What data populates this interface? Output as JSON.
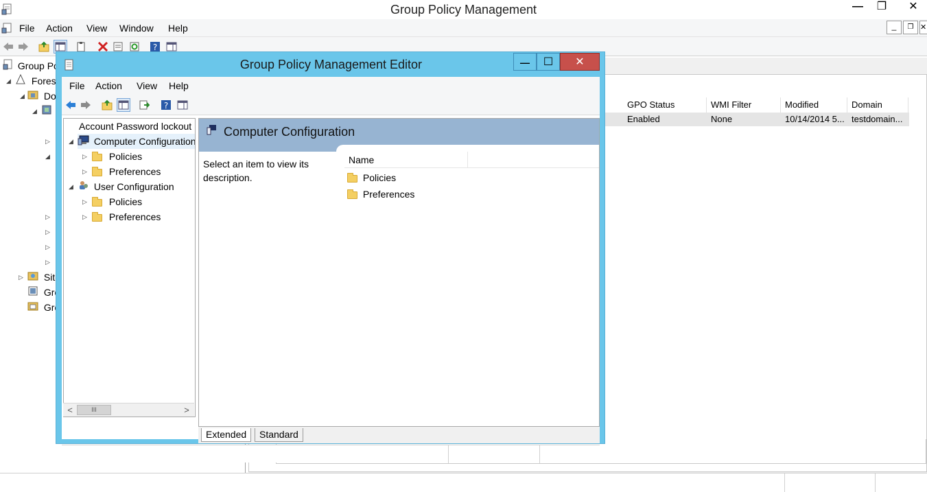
{
  "main_window": {
    "title": "Group Policy Management",
    "menu": [
      "File",
      "Action",
      "View",
      "Window",
      "Help"
    ],
    "caption_buttons": {
      "minimize": "—",
      "maximize": "❐",
      "close": "✕"
    },
    "child_buttons": {
      "minimize": "_",
      "restore": "❐",
      "close": "✕"
    },
    "tree": [
      {
        "label": "Group Po",
        "indent": 0
      },
      {
        "label": "Forest",
        "indent": 1
      },
      {
        "label": "Do",
        "indent": 2
      },
      {
        "label": "",
        "indent": 3
      },
      {
        "label": "Site",
        "indent": 1
      },
      {
        "label": "Gro",
        "indent": 1
      },
      {
        "label": "Gro",
        "indent": 1
      }
    ],
    "table": {
      "columns": [
        "GPO Status",
        "WMI Filter",
        "Modified",
        "Domain"
      ],
      "rows": [
        {
          "gpo_status": "Enabled",
          "wmi_filter": "None",
          "modified": "10/14/2014 5...",
          "domain": "testdomain..."
        }
      ]
    }
  },
  "editor_window": {
    "title": "Group Policy Management Editor",
    "menu": [
      "File",
      "Action",
      "View",
      "Help"
    ],
    "caption_buttons": {
      "minimize": "—",
      "maximize": "☐",
      "close": "✕"
    },
    "tree": {
      "root": "Account Password lockout",
      "computer_configuration": "Computer Configuration",
      "computer_children": [
        "Policies",
        "Preferences"
      ],
      "user_configuration": "User Configuration",
      "user_children": [
        "Policies",
        "Preferences"
      ]
    },
    "scrollbar": {
      "left": "<",
      "thumb": "III",
      "right": ">"
    },
    "content": {
      "header": "Computer Configuration",
      "description": "Select an item to view its description.",
      "list_column": "Name",
      "items": [
        "Policies",
        "Preferences"
      ]
    },
    "tabs": [
      "Extended",
      "Standard"
    ],
    "active_tab": "Extended"
  },
  "colors": {
    "editor_frame": "#6ac6ea",
    "content_header": "#97b4d2",
    "close_button": "#c7504b",
    "folder": "#f4cf62"
  }
}
